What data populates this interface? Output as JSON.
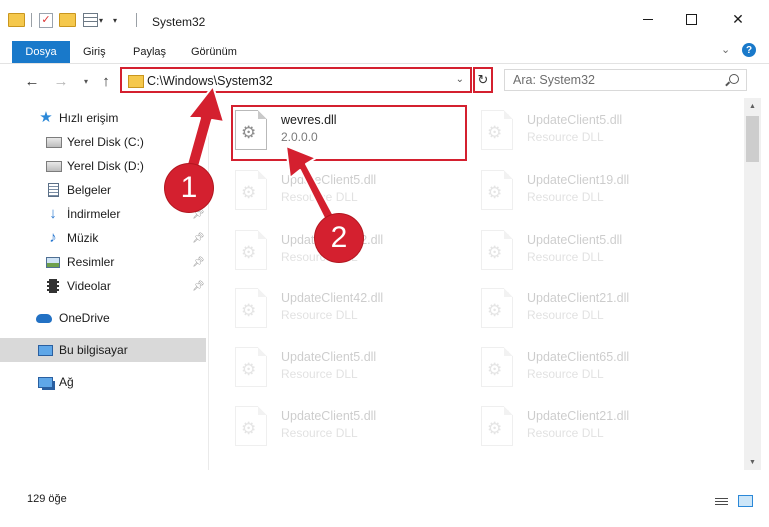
{
  "window": {
    "title": "System32",
    "controls": {
      "minimize": "",
      "maximize": "",
      "close": "✕"
    }
  },
  "ribbon": {
    "tabs": [
      {
        "label": "Dosya",
        "active": true
      },
      {
        "label": "Giriş"
      },
      {
        "label": "Paylaş"
      },
      {
        "label": "Görünüm"
      }
    ],
    "help": "?"
  },
  "nav": {
    "address": "C:\\Windows\\System32",
    "search_placeholder": "Ara: System32"
  },
  "sidebar": {
    "items": [
      {
        "label": "Hızlı erişim",
        "icon": "star-icon"
      },
      {
        "label": "Yerel Disk (C:)",
        "icon": "drive-icon"
      },
      {
        "label": "Yerel Disk (D:)",
        "icon": "drive-icon"
      },
      {
        "label": "Belgeler",
        "icon": "documents-icon",
        "pinned": true
      },
      {
        "label": "İndirmeler",
        "icon": "downloads-icon",
        "pinned": true
      },
      {
        "label": "Müzik",
        "icon": "music-icon",
        "pinned": true
      },
      {
        "label": "Resimler",
        "icon": "pictures-icon",
        "pinned": true
      },
      {
        "label": "Videolar",
        "icon": "videos-icon",
        "pinned": true
      },
      {
        "label": "OneDrive",
        "icon": "onedrive-icon"
      },
      {
        "label": "Bu bilgisayar",
        "icon": "this-pc-icon",
        "selected": true
      },
      {
        "label": "Ağ",
        "icon": "network-icon"
      }
    ]
  },
  "files": {
    "highlighted": {
      "name": "wevres.dll",
      "type": "2.0.0.0"
    },
    "left_column": [
      {
        "name": "UpdateClient5.dll",
        "type": "Resource DLL"
      },
      {
        "name": "UpdateClient42.dll",
        "type": "Resource DLL"
      },
      {
        "name": "UpdateClient42.dll",
        "type": "Resource DLL"
      },
      {
        "name": "UpdateClient5.dll",
        "type": "Resource DLL"
      },
      {
        "name": "UpdateClient5.dll",
        "type": "Resource DLL"
      }
    ],
    "right_column": [
      {
        "name": "UpdateClient5.dll",
        "type": "Resource DLL"
      },
      {
        "name": "UpdateClient19.dll",
        "type": "Resource DLL"
      },
      {
        "name": "UpdateClient5.dll",
        "type": "Resource DLL"
      },
      {
        "name": "UpdateClient21.dll",
        "type": "Resource DLL"
      },
      {
        "name": "UpdateClient65.dll",
        "type": "Resource DLL"
      },
      {
        "name": "UpdateClient21.dll",
        "type": "Resource DLL"
      }
    ]
  },
  "status": {
    "count": "129 öğe"
  },
  "callouts": {
    "step1": "1",
    "step2": "2"
  },
  "colors": {
    "accent": "#1979ca",
    "callout": "#d4202f",
    "selected_bg": "#d9d9d9"
  }
}
